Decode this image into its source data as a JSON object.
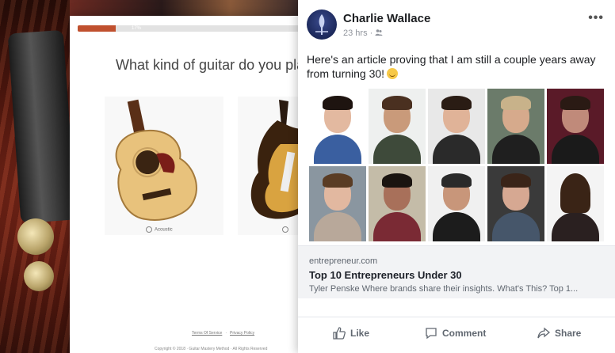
{
  "quiz": {
    "progress_label": "17%",
    "progress": 0.17,
    "question": "What kind of guitar do you pla",
    "options": [
      {
        "label": "Acoustic"
      },
      {
        "label": ""
      }
    ],
    "footer_links": [
      "Terms Of Service",
      "Privacy Policy"
    ],
    "copyright": "Copyright © 2018 · Guitar Mastery Method · All Rights Reserved"
  },
  "post": {
    "author": "Charlie Wallace",
    "time": "23 hrs",
    "privacy_icon": "friends-icon",
    "more_label": "•••",
    "status": "Here's an article proving that I am still a couple years away from turning 30!",
    "link": {
      "domain": "entrepreneur.com",
      "title": "Top 10 Entrepreneurs Under 30",
      "description": "Tyler Penske Where brands share their insights. What's This? Top 1..."
    },
    "actions": {
      "like": "Like",
      "comment": "Comment",
      "share": "Share"
    }
  }
}
